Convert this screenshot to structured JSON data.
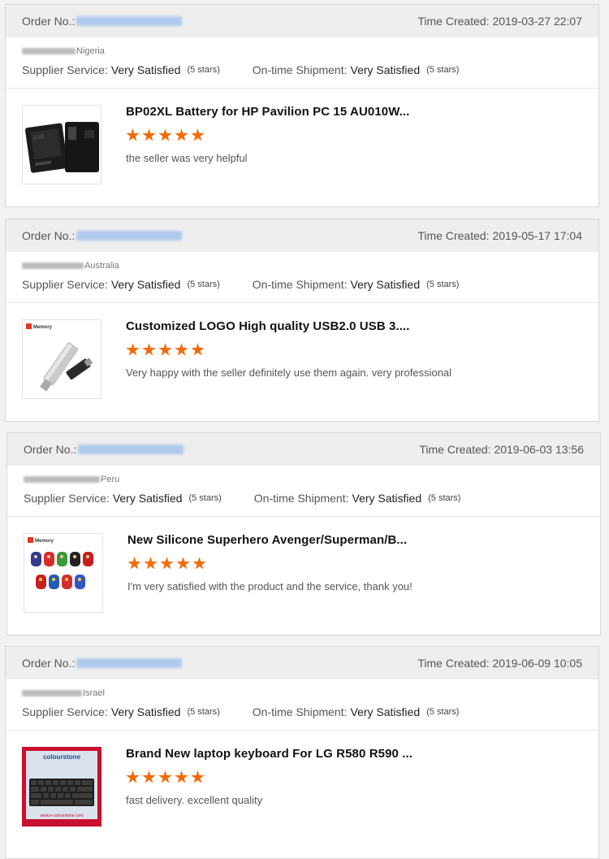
{
  "labels": {
    "order_no": "Order No.:",
    "time_created": "Time Created:",
    "supplier_service": "Supplier Service:",
    "ontime_shipment": "On-time Shipment:"
  },
  "reviews": [
    {
      "time": "2019-03-27 22:07",
      "country": "Nigeria",
      "supplier_rating": "Very Satisfied",
      "supplier_stars": "(5 stars)",
      "shipment_rating": "Very Satisfied",
      "shipment_stars": "(5 stars)",
      "product_title": "BP02XL Battery for HP Pavilion PC 15 AU010W...",
      "stars": 5,
      "comment": "the seller was very helpful",
      "thumbnail": "battery-image"
    },
    {
      "time": "2019-05-17 17:04",
      "country": "Australia",
      "supplier_rating": "Very Satisfied",
      "supplier_stars": "(5 stars)",
      "shipment_rating": "Very Satisfied",
      "shipment_stars": "(5 stars)",
      "product_title": "Customized LOGO High quality USB2.0 USB 3....",
      "stars": 5,
      "comment": "Very happy with the seller definitely use them again. very professional",
      "thumbnail": "usb-drive-image",
      "brand_text": "Memory"
    },
    {
      "time": "2019-06-03 13:56",
      "country": "Peru",
      "supplier_rating": "Very Satisfied",
      "supplier_stars": "(5 stars)",
      "shipment_rating": "Very Satisfied",
      "shipment_stars": "(5 stars)",
      "product_title": "New Silicone Superhero Avenger/Superman/B...",
      "stars": 5,
      "comment": "I'm very satisfied with the product and the service, thank you!",
      "thumbnail": "superhero-usb-image",
      "brand_text": "Memory"
    },
    {
      "time": "2019-06-09 10:05",
      "country": "Israel",
      "supplier_rating": "Very Satisfied",
      "supplier_stars": "(5 stars)",
      "shipment_rating": "Very Satisfied",
      "shipment_stars": "(5 stars)",
      "product_title": "Brand New laptop keyboard For LG R580 R590 ...",
      "stars": 5,
      "comment": "fast delivery. excellent quality",
      "thumbnail": "keyboard-image",
      "brand_text": "colourstone",
      "footer_text": "www.e-colourstone.com"
    }
  ],
  "colors": {
    "star": "#f56a07",
    "header_bg": "#eeeeee",
    "blurred_link": "#a9c7ec"
  }
}
